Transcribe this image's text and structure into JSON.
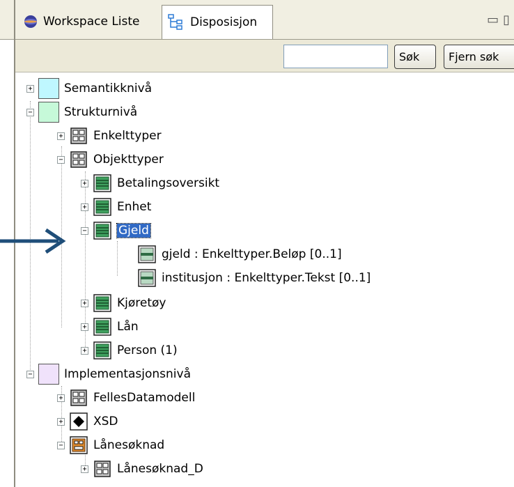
{
  "tabs": [
    {
      "label": "Workspace Liste",
      "icon": "globe-icon",
      "active": false
    },
    {
      "label": "Disposisjon",
      "icon": "outline-icon",
      "active": true
    }
  ],
  "toolbar": {
    "search_value": "",
    "search_label": "Søk",
    "clear_label": "Fjern søk"
  },
  "colors": {
    "selection": "#316ac5",
    "arrow": "#1f4e79",
    "semantic_level": "#bff7ff",
    "structure_level": "#c6f9d9",
    "implementation_level": "#f0e2fb"
  },
  "tree": {
    "semantic": {
      "label": "Semantikknivå",
      "icon": "cyan-square-icon",
      "state": "collapsed"
    },
    "structure": {
      "label": "Strukturnivå",
      "icon": "green-square-icon",
      "state": "expanded",
      "simple_types": {
        "label": "Enkelttyper",
        "icon": "package-icon",
        "state": "collapsed"
      },
      "object_types": {
        "label": "Objekttyper",
        "icon": "package-icon",
        "state": "expanded",
        "items": [
          {
            "label": "Betalingsoversikt",
            "icon": "class-icon",
            "state": "collapsed"
          },
          {
            "label": "Enhet",
            "icon": "class-icon",
            "state": "collapsed"
          },
          {
            "label": "Gjeld",
            "icon": "class-icon",
            "state": "expanded",
            "selected": true,
            "attributes": [
              {
                "label": "gjeld : Enkelttyper.Beløp [0..1]",
                "icon": "attribute-icon"
              },
              {
                "label": "institusjon : Enkelttyper.Tekst [0..1]",
                "icon": "attribute-icon"
              }
            ]
          },
          {
            "label": "Kjøretøy",
            "icon": "class-icon",
            "state": "collapsed"
          },
          {
            "label": "Lån",
            "icon": "class-icon",
            "state": "collapsed"
          },
          {
            "label": "Person (1)",
            "icon": "class-icon",
            "state": "collapsed"
          }
        ]
      }
    },
    "implementation": {
      "label": "Implementasjonsnivå",
      "icon": "lilac-square-icon",
      "state": "expanded",
      "items": [
        {
          "label": "FellesDatamodell",
          "icon": "package-icon",
          "state": "collapsed"
        },
        {
          "label": "XSD",
          "icon": "diamond-icon",
          "state": "collapsed"
        },
        {
          "label": "Lånesøknad",
          "icon": "component-icon",
          "state": "expanded",
          "children": [
            {
              "label": "Lånesøknad_D",
              "icon": "package-icon",
              "state": "collapsed"
            }
          ]
        }
      ]
    }
  }
}
